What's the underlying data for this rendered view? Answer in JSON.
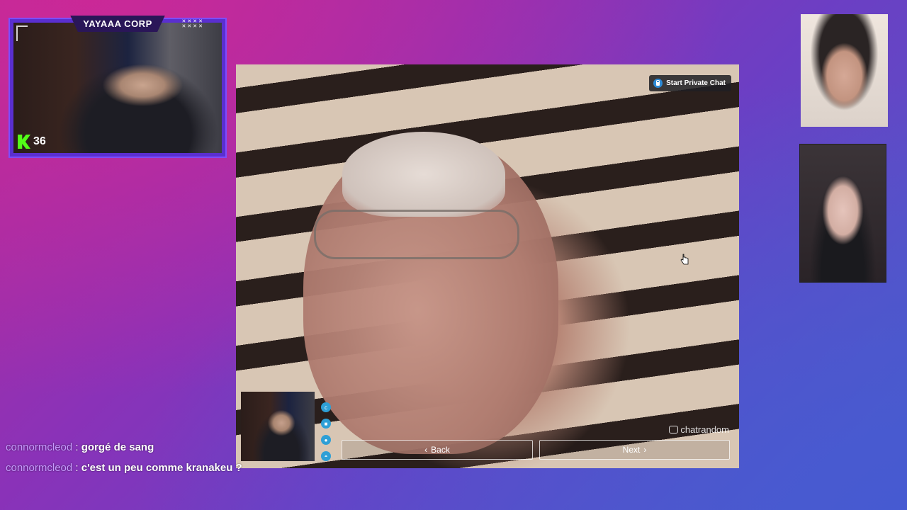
{
  "webcam": {
    "title": "YAYAAA CORP",
    "sub_count": "36",
    "icons": [
      "kick-icon"
    ]
  },
  "main_video": {
    "private_chat_label": "Start Private Chat",
    "watermark": "chatrandom",
    "back_label": "Back",
    "next_label": "Next",
    "back_chevron": "‹",
    "next_chevron": "›",
    "control_icons": [
      "chatrandom-logo-icon",
      "video-camera-icon",
      "microphone-icon",
      "mask-icon"
    ]
  },
  "chat": {
    "messages": [
      {
        "user": "connormcleod",
        "text": "gorgé de sang"
      },
      {
        "user": "connormcleod",
        "text": "c'est un peu comme kranakeu ?"
      }
    ]
  },
  "colors": {
    "accent_purple": "#5a2fd0",
    "kick_green": "#53fc18",
    "chat_username": "#c79bff",
    "control_blue": "#2e9fd6"
  }
}
